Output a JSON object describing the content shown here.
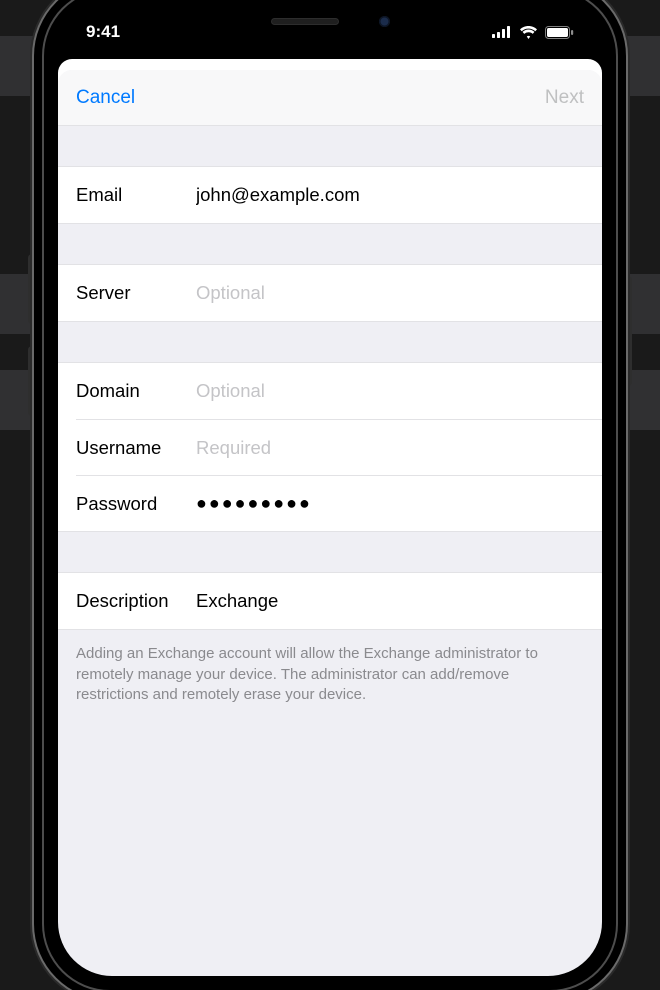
{
  "status": {
    "time": "9:41"
  },
  "nav": {
    "cancel": "Cancel",
    "next": "Next"
  },
  "fields": {
    "email": {
      "label": "Email",
      "value": "john@example.com",
      "placeholder": ""
    },
    "server": {
      "label": "Server",
      "value": "",
      "placeholder": "Optional"
    },
    "domain": {
      "label": "Domain",
      "value": "",
      "placeholder": "Optional"
    },
    "username": {
      "label": "Username",
      "value": "",
      "placeholder": "Required"
    },
    "password": {
      "label": "Password",
      "value": "●●●●●●●●●",
      "placeholder": ""
    },
    "description": {
      "label": "Description",
      "value": "Exchange",
      "placeholder": ""
    }
  },
  "footer": "Adding an Exchange account will allow the Exchange administrator to remotely manage your device. The administrator can add/remove restrictions and remotely erase your device."
}
